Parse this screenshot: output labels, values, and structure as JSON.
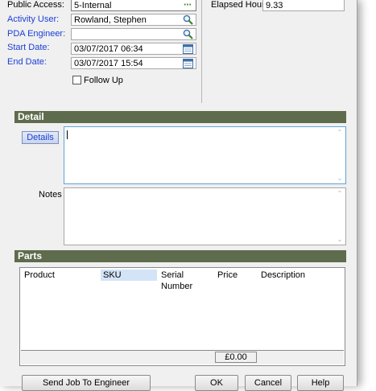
{
  "form": {
    "public_access": {
      "label": "Public Access:",
      "value": "5-Internal"
    },
    "activity_user": {
      "label": "Activity User:",
      "value": "Rowland, Stephen"
    },
    "pda_engineer": {
      "label": "PDA Engineer:",
      "value": ""
    },
    "start_date": {
      "label": "Start Date:",
      "value": "03/07/2017 06:34"
    },
    "end_date": {
      "label": "End Date:",
      "value": "03/07/2017 15:54"
    },
    "follow_up": {
      "label": "Follow Up",
      "checked": false
    },
    "elapsed_hours": {
      "label": "Elapsed Hours:",
      "value": "9.33"
    }
  },
  "detail": {
    "title": "Detail",
    "details_button": "Details",
    "details_value": "",
    "notes_label": "Notes",
    "notes_value": ""
  },
  "parts": {
    "title": "Parts",
    "columns": [
      "Product",
      "SKU",
      "Serial Number",
      "Price",
      "Description"
    ],
    "selected_column": "SKU",
    "total": "£0.00"
  },
  "buttons": {
    "send_job": "Send Job To Engineer",
    "ok": "OK",
    "cancel": "Cancel",
    "help": "Help"
  },
  "icons": {
    "public_access": "ellipsis-icon",
    "activity_user": "magnifier-icon",
    "pda_engineer": "magnifier-icon",
    "start_date": "calendar-icon",
    "end_date": "calendar-icon"
  },
  "colors": {
    "section_bar": "#5f6b4d",
    "link_label": "#1a3fd6",
    "focus_border": "#5fa3d8"
  }
}
